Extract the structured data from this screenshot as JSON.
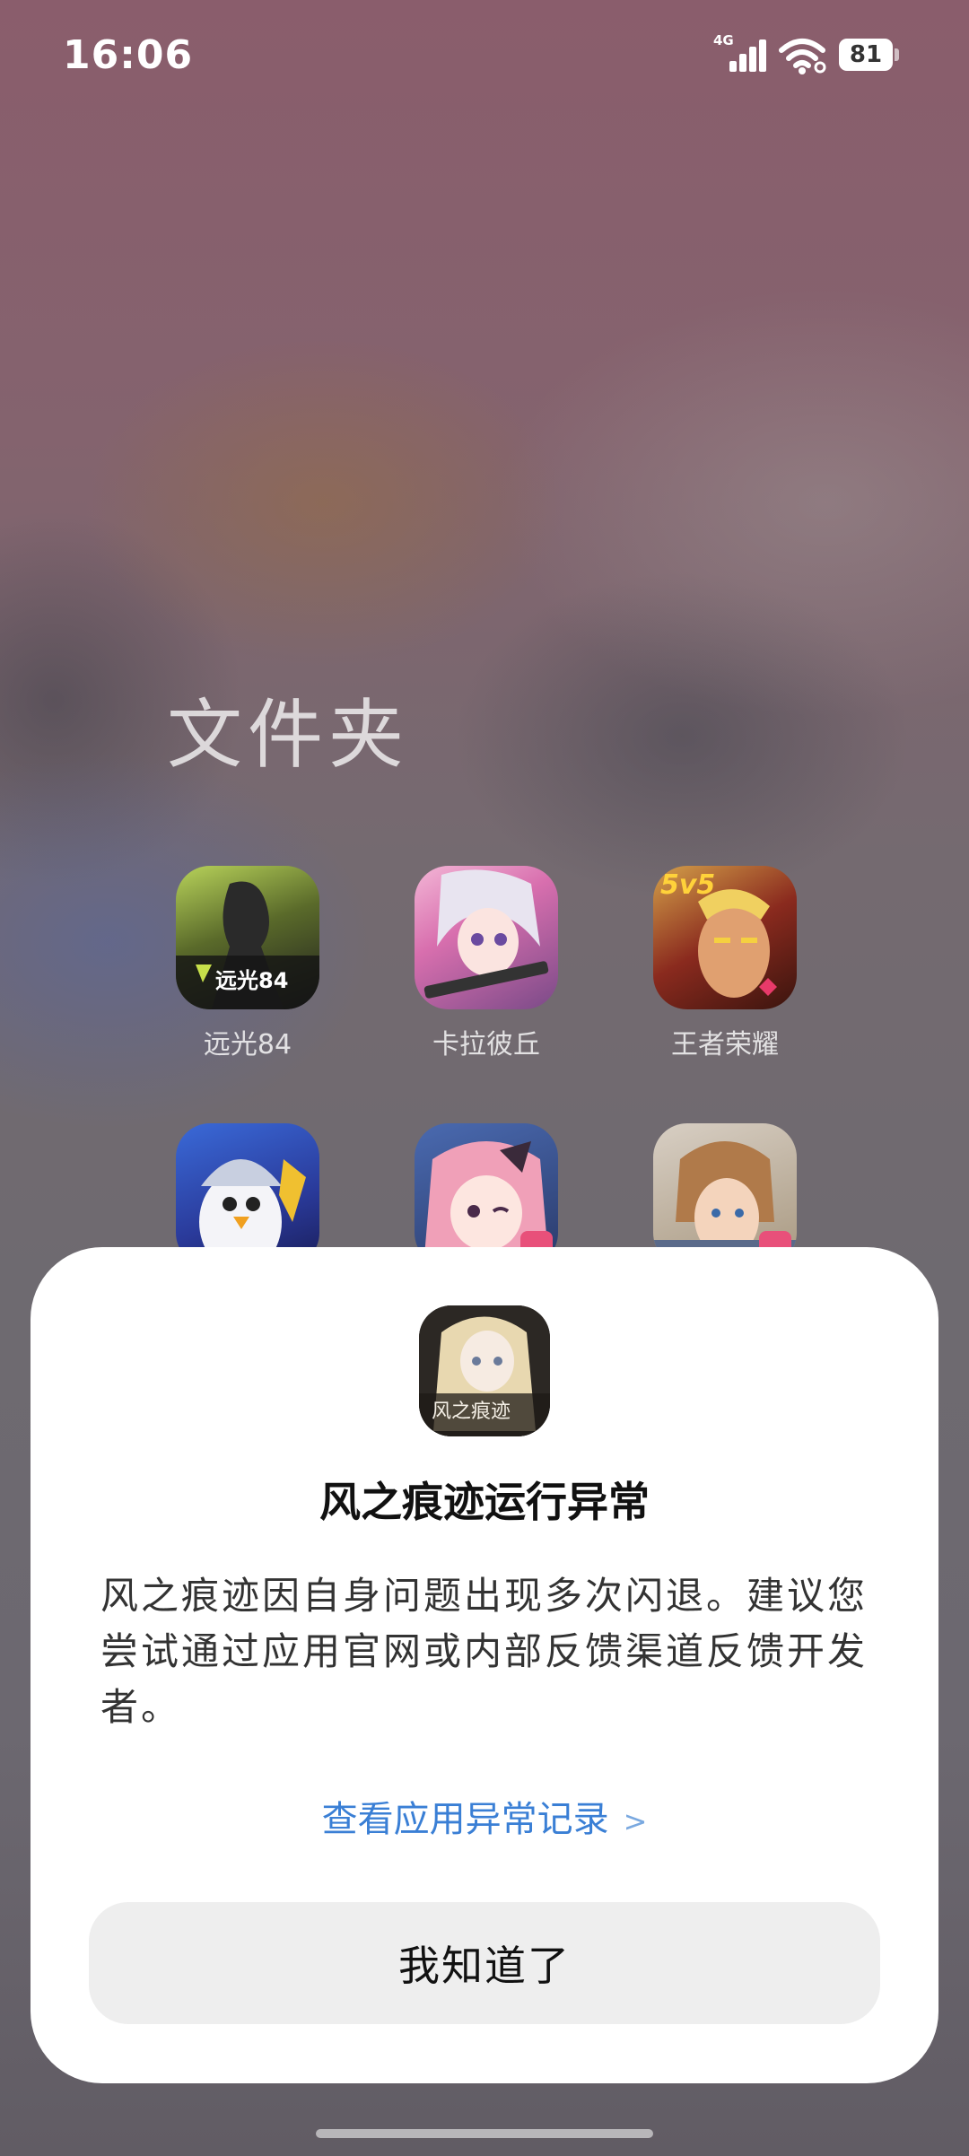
{
  "status_bar": {
    "time": "16:06",
    "network": "4G",
    "battery": "81",
    "icons": [
      "signal-icon",
      "wifi-icon",
      "battery-icon"
    ]
  },
  "folder": {
    "title": "文件夹",
    "apps": [
      {
        "label": "远光84",
        "icon": "yuanguang84-app-icon",
        "icon_text": "远光84"
      },
      {
        "label": "卡拉彼丘",
        "icon": "kalabiqiu-app-icon"
      },
      {
        "label": "王者荣耀",
        "icon": "wangzherongyao-app-icon",
        "icon_text": "5v5"
      },
      {
        "label": "",
        "icon": "penguin-game-app-icon"
      },
      {
        "label": "",
        "icon": "anime-girl-game-app-icon"
      },
      {
        "label": "",
        "icon": "anime-boy-game-app-icon"
      }
    ]
  },
  "dialog": {
    "app_icon": "fengzhihenji-app-icon",
    "app_icon_text": "风之痕迹",
    "title": "风之痕迹运行异常",
    "message": "风之痕迹因自身问题出现多次闪退。建议您尝试通过应用官网或内部反馈渠道反馈开发者。",
    "link": "查看应用异常记录",
    "link_chevron": ">",
    "button": "我知道了",
    "colors": {
      "link": "#3a7fd5",
      "button_bg": "#eeeeee"
    }
  }
}
